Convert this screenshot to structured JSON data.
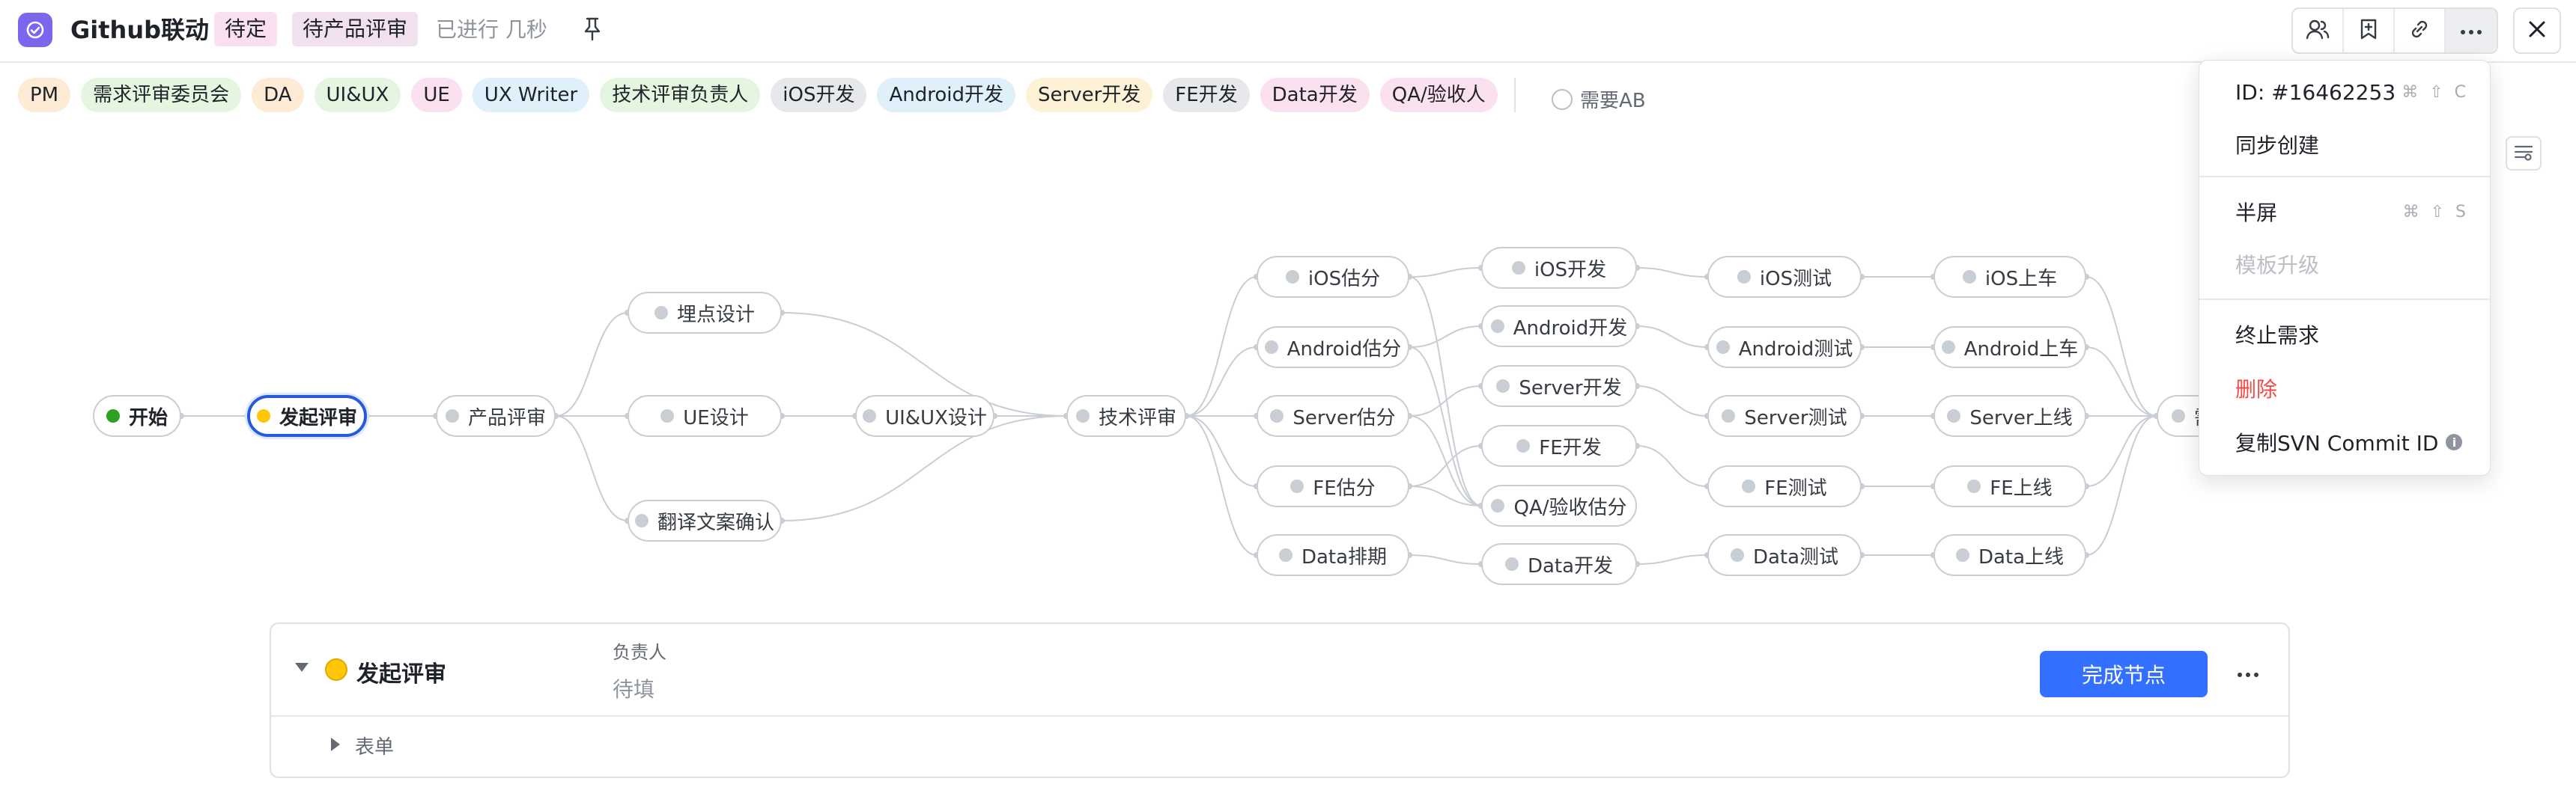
{
  "header": {
    "title": "Github联动",
    "status_tag": "待定",
    "stage_tag": "待产品评审",
    "progress": "已进行 几秒"
  },
  "roles": [
    {
      "label": "PM",
      "color": "#fdebd6"
    },
    {
      "label": "需求评审委员会",
      "color": "#e4f5e0"
    },
    {
      "label": "DA",
      "color": "#fdebd6"
    },
    {
      "label": "UI&UX",
      "color": "#e4f5e0"
    },
    {
      "label": "UE",
      "color": "#fbe0ef"
    },
    {
      "label": "UX Writer",
      "color": "#dff0fb"
    },
    {
      "label": "技术评审负责人",
      "color": "#e4f5e0"
    },
    {
      "label": "iOS开发",
      "color": "#e6e8eb"
    },
    {
      "label": "Android开发",
      "color": "#dff0fb"
    },
    {
      "label": "Server开发",
      "color": "#fdf1d6"
    },
    {
      "label": "FE开发",
      "color": "#e6e8eb"
    },
    {
      "label": "Data开发",
      "color": "#fbe0ef"
    },
    {
      "label": "QA/验收人",
      "color": "#fbe0ef"
    }
  ],
  "ab_option": "需要AB",
  "flow": {
    "nodes": [
      {
        "id": "start",
        "label": "开始"
      },
      {
        "id": "launch",
        "label": "发起评审"
      },
      {
        "id": "prd",
        "label": "产品评审"
      },
      {
        "id": "track",
        "label": "埋点设计"
      },
      {
        "id": "ue",
        "label": "UE设计"
      },
      {
        "id": "trans",
        "label": "翻译文案确认"
      },
      {
        "id": "uiux",
        "label": "UI&UX设计"
      },
      {
        "id": "tech",
        "label": "技术评审"
      },
      {
        "id": "ios_est",
        "label": "iOS估分"
      },
      {
        "id": "and_est",
        "label": "Android估分"
      },
      {
        "id": "srv_est",
        "label": "Server估分"
      },
      {
        "id": "fe_est",
        "label": "FE估分"
      },
      {
        "id": "data_plan",
        "label": "Data排期"
      },
      {
        "id": "ios_dev",
        "label": "iOS开发"
      },
      {
        "id": "and_dev",
        "label": "Android开发"
      },
      {
        "id": "srv_dev",
        "label": "Server开发"
      },
      {
        "id": "fe_dev",
        "label": "FE开发"
      },
      {
        "id": "qa_est",
        "label": "QA/验收估分"
      },
      {
        "id": "data_dev",
        "label": "Data开发"
      },
      {
        "id": "ios_test",
        "label": "iOS测试"
      },
      {
        "id": "and_test",
        "label": "Android测试"
      },
      {
        "id": "srv_test",
        "label": "Server测试"
      },
      {
        "id": "fe_test",
        "label": "FE测试"
      },
      {
        "id": "data_test",
        "label": "Data测试"
      },
      {
        "id": "ios_rel",
        "label": "iOS上车"
      },
      {
        "id": "and_rel",
        "label": "Android上车"
      },
      {
        "id": "srv_rel",
        "label": "Server上线"
      },
      {
        "id": "fe_rel",
        "label": "FE上线"
      },
      {
        "id": "data_rel",
        "label": "Data上线"
      },
      {
        "id": "end",
        "label": "需"
      }
    ],
    "edges": [
      [
        "start",
        "launch"
      ],
      [
        "launch",
        "prd"
      ],
      [
        "prd",
        "track"
      ],
      [
        "prd",
        "ue"
      ],
      [
        "prd",
        "trans"
      ],
      [
        "ue",
        "uiux"
      ],
      [
        "track",
        "tech"
      ],
      [
        "uiux",
        "tech"
      ],
      [
        "trans",
        "tech"
      ],
      [
        "tech",
        "ios_est"
      ],
      [
        "tech",
        "and_est"
      ],
      [
        "tech",
        "srv_est"
      ],
      [
        "tech",
        "fe_est"
      ],
      [
        "tech",
        "data_plan"
      ],
      [
        "ios_est",
        "ios_dev"
      ],
      [
        "and_est",
        "and_dev"
      ],
      [
        "srv_est",
        "srv_dev"
      ],
      [
        "fe_est",
        "fe_dev"
      ],
      [
        "data_plan",
        "data_dev"
      ],
      [
        "ios_est",
        "qa_est"
      ],
      [
        "and_est",
        "qa_est"
      ],
      [
        "srv_est",
        "qa_est"
      ],
      [
        "fe_est",
        "qa_est"
      ],
      [
        "ios_dev",
        "ios_test"
      ],
      [
        "and_dev",
        "and_test"
      ],
      [
        "srv_dev",
        "srv_test"
      ],
      [
        "fe_dev",
        "fe_test"
      ],
      [
        "data_dev",
        "data_test"
      ],
      [
        "ios_test",
        "ios_rel"
      ],
      [
        "and_test",
        "and_rel"
      ],
      [
        "srv_test",
        "srv_rel"
      ],
      [
        "fe_test",
        "fe_rel"
      ],
      [
        "data_test",
        "data_rel"
      ],
      [
        "ios_rel",
        "end"
      ],
      [
        "and_rel",
        "end"
      ],
      [
        "srv_rel",
        "end"
      ],
      [
        "fe_rel",
        "end"
      ],
      [
        "data_rel",
        "end"
      ]
    ]
  },
  "panel": {
    "node_title": "发起评审",
    "owner_label": "负责人",
    "owner_value": "待填",
    "complete_button": "完成节点",
    "form_label": "表单"
  },
  "menu": {
    "id": "ID: #16462253",
    "id_shortcut": "⌘ ⇧ C",
    "sync_create": "同步创建",
    "half_screen": "半屏",
    "half_shortcut": "⌘ ⇧ S",
    "template_upgrade": "模板升级",
    "terminate": "终止需求",
    "delete": "删除",
    "copy_svn": "复制SVN Commit ID"
  },
  "colors": {
    "primary": "#3370ff",
    "active_border": "#245bdb",
    "danger": "#f54a45",
    "app_icon": "#7b67ee"
  }
}
